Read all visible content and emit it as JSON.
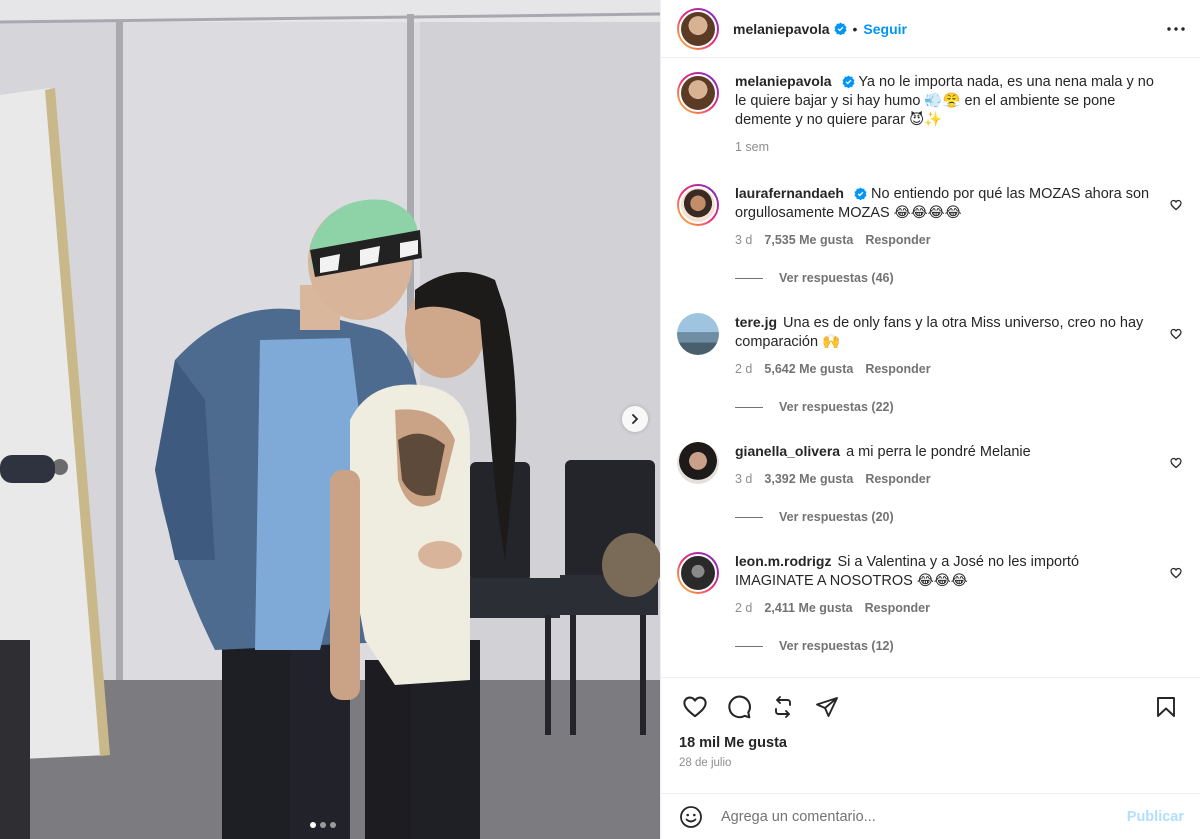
{
  "post": {
    "author": "melaniepavola",
    "follow_label": "Seguir",
    "separator": "•",
    "caption": {
      "username": "melaniepavola",
      "text": "Ya no le importa nada, es una nena mala y no le quiere bajar y si hay humo 💨😤 en el ambiente se pone demente y no quiere parar 😈✨",
      "time": "1 sem"
    },
    "comments": [
      {
        "username": "laurafernandaeh",
        "verified": true,
        "text": "No entiendo por qué las MOZAS ahora son orgullosamente MOZAS 😂😂😂😂",
        "time": "3 d",
        "likes": "7,535 Me gusta",
        "reply": "Responder",
        "view_replies": "Ver respuestas (46)"
      },
      {
        "username": "tere.jg",
        "verified": false,
        "text": "Una es de only fans y la otra Miss universo, creo no hay comparación 🙌",
        "time": "2 d",
        "likes": "5,642 Me gusta",
        "reply": "Responder",
        "view_replies": "Ver respuestas (22)"
      },
      {
        "username": "gianella_olivera",
        "verified": false,
        "text": "a mi perra le pondré Melanie",
        "time": "3 d",
        "likes": "3,392 Me gusta",
        "reply": "Responder",
        "view_replies": "Ver respuestas (20)"
      },
      {
        "username": "leon.m.rodrigz",
        "verified": false,
        "text": "Si a Valentina y a José no les importó IMAGINATE A NOSOTROS 😂😂😂",
        "time": "2 d",
        "likes": "2,411 Me gusta",
        "reply": "Responder",
        "view_replies": "Ver respuestas (12)"
      }
    ],
    "like_count": "18 mil Me gusta",
    "date": "28 de julio",
    "composer": {
      "placeholder": "Agrega un comentario...",
      "publish_label": "Publicar"
    },
    "carousel": {
      "count": 3,
      "active": 0
    },
    "colors": {
      "accent": "#0095f6",
      "verified": "#0095f6",
      "publish_disabled": "#b2dffc"
    }
  }
}
